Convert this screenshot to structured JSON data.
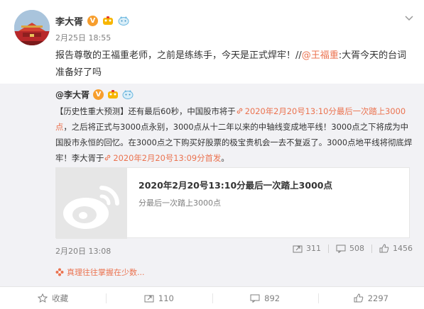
{
  "post": {
    "author": "李大胥",
    "time": "2月25日 18:55",
    "text_prefix": "报告尊敬的王福重老师，之前是练练手，今天是正式焊牢！//",
    "mention": "@王福重",
    "text_suffix": ":大胥今天的台词 准备好了吗"
  },
  "retweet": {
    "author": "@李大胥",
    "text_1": "【历史性重大预测】还有最后60秒，中国股市将于",
    "link_1": "2020年2月20号13:10分最后一次踏上3000点",
    "text_2": "，之后将正式与3000点永别，3000点从十二年以来的中轴线变成地平线！3000点之下将成为中国股市永恒的回忆。在3000点之下购买好股票的极宝贵机会一去不复返了。3000点地平线将彻底焊牢！李大胥于",
    "link_2": "2020年2月20号13:09分首发",
    "text_3": "。",
    "card_title": "2020年2月20号13:10分最后一次踏上3000点",
    "card_sub": "分最后一次踏上3000点",
    "time": "2月20日 13:08",
    "forwards": "311",
    "comments": "508",
    "likes": "1456"
  },
  "note": "真理往往掌握在少数...",
  "actions": {
    "favorite": "收藏",
    "forward": "110",
    "comment": "892",
    "like": "2297"
  },
  "colors": {
    "link": "#eb7350",
    "badge": "#f79e2d",
    "muted": "#808080",
    "retweet_bg": "#f2f2f5"
  }
}
